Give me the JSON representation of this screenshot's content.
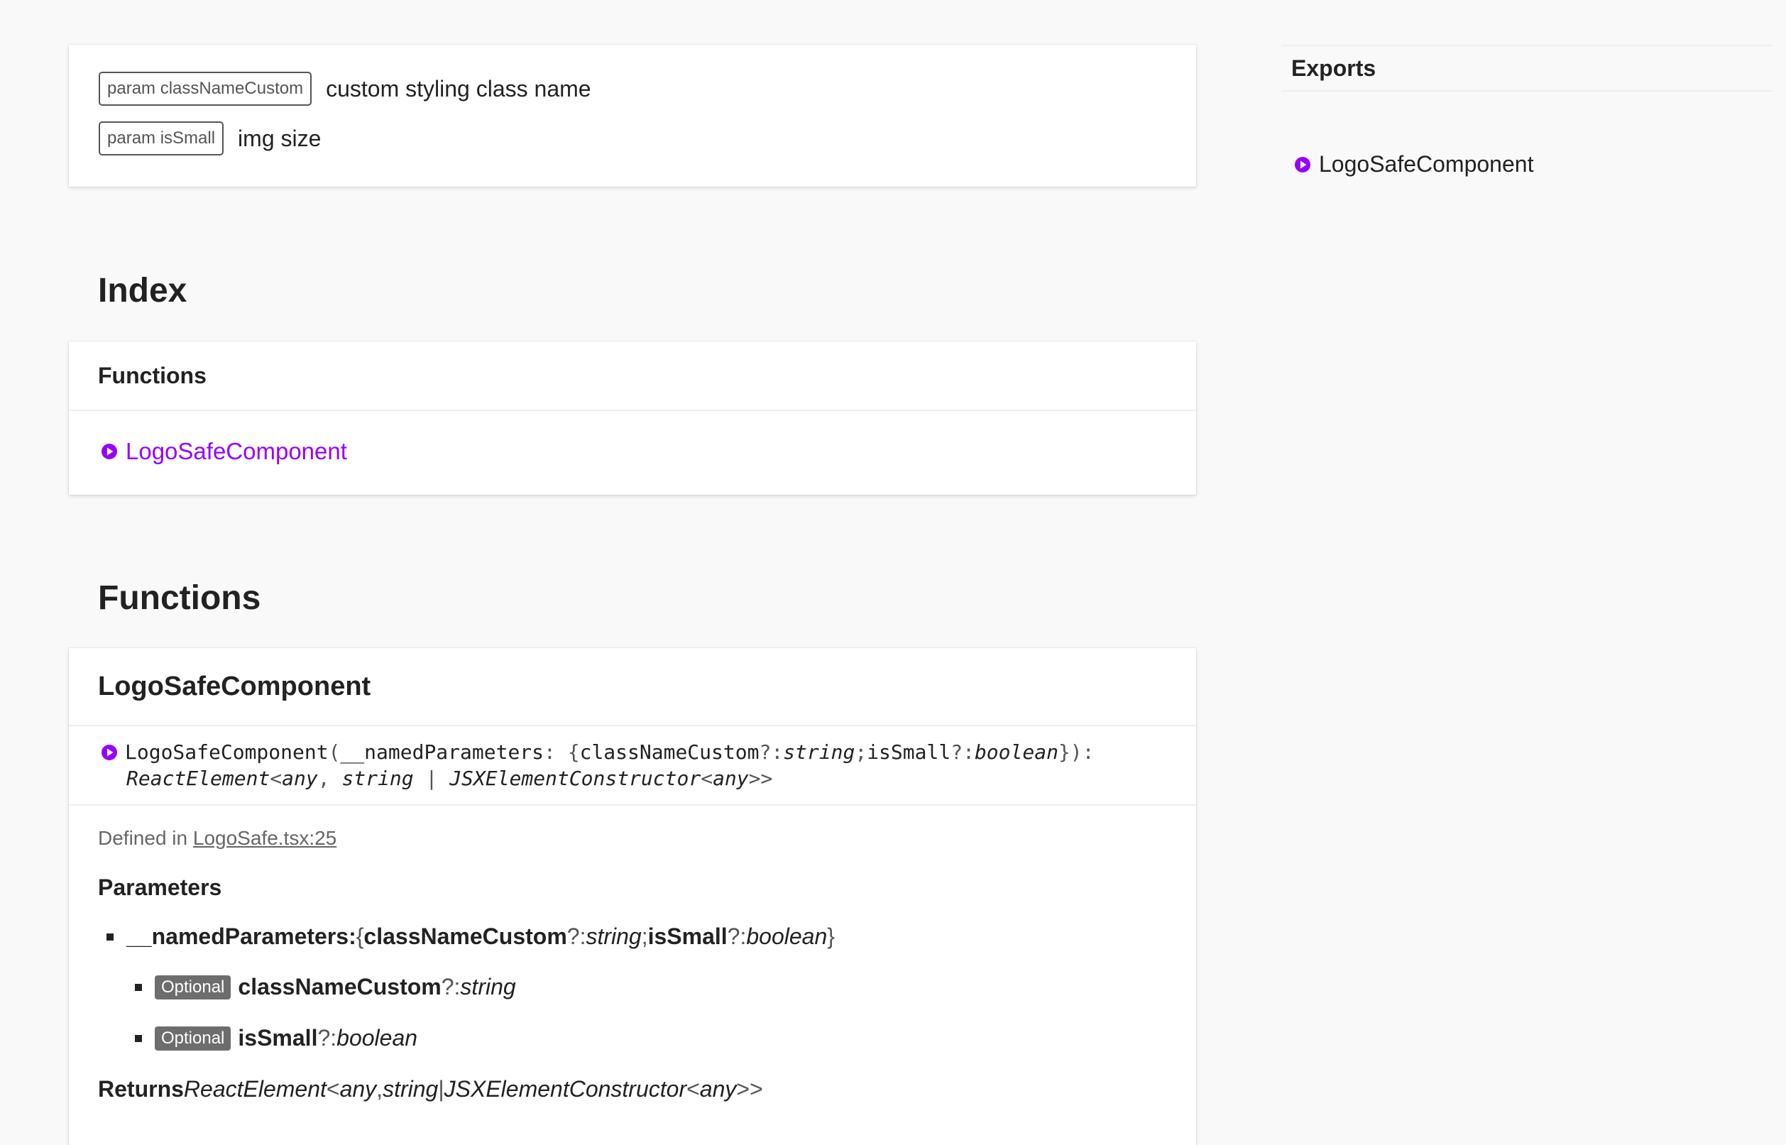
{
  "comment": {
    "tags": [
      {
        "tag": "param classNameCustom",
        "text": "custom styling class name"
      },
      {
        "tag": "param isSmall",
        "text": "img size"
      }
    ]
  },
  "index": {
    "heading": "Index",
    "group_title": "Functions",
    "item": "LogoSafeComponent"
  },
  "functions": {
    "heading": "Functions",
    "name": "LogoSafeComponent",
    "signature": {
      "name": "LogoSafeComponent",
      "open": "(",
      "param": "__namedParameters",
      "colon": ": { ",
      "p1": "classNameCustom",
      "opt1": "?: ",
      "t1": "string",
      "sep": "; ",
      "p2": "isSmall",
      "opt2": "?: ",
      "t2": "boolean",
      "close": " }):",
      "ret1": "ReactElement",
      "lt1": "<",
      "ret_any": "any",
      "comma": ", ",
      "ret_string": "string",
      "pipe": " | ",
      "ret_jsx": "JSXElementConstructor",
      "lt2": "<",
      "ret_any2": "any",
      "gt": ">>"
    },
    "defined_prefix": "Defined in ",
    "defined_link": "LogoSafe.tsx:25",
    "parameters_title": "Parameters",
    "named_param": {
      "name": "__namedParameters:",
      "open": " { ",
      "p1": "classNameCustom",
      "opt1": "?: ",
      "t1": "string",
      "sep": "; ",
      "p2": "isSmall",
      "opt2": "?: ",
      "t2": "boolean",
      "close": " }"
    },
    "sub_params": [
      {
        "badge": "Optional",
        "name": "classNameCustom",
        "opt": "?: ",
        "type": "string"
      },
      {
        "badge": "Optional",
        "name": "isSmall",
        "opt": "?: ",
        "type": "boolean"
      }
    ],
    "returns": {
      "label": "Returns ",
      "t1": "ReactElement",
      "lt1": "<",
      "any": "any",
      "comma": ", ",
      "string": "string",
      "pipe": " | ",
      "jsx": "JSXElementConstructor",
      "lt2": "<",
      "any2": "any",
      "gt": ">>"
    }
  },
  "sidebar": {
    "exports_title": "Exports",
    "item": "LogoSafeComponent"
  },
  "colors": {
    "accent": "#9600ff",
    "badge": "#6d6d6d"
  },
  "icons": {
    "function_icon": "function-icon"
  }
}
